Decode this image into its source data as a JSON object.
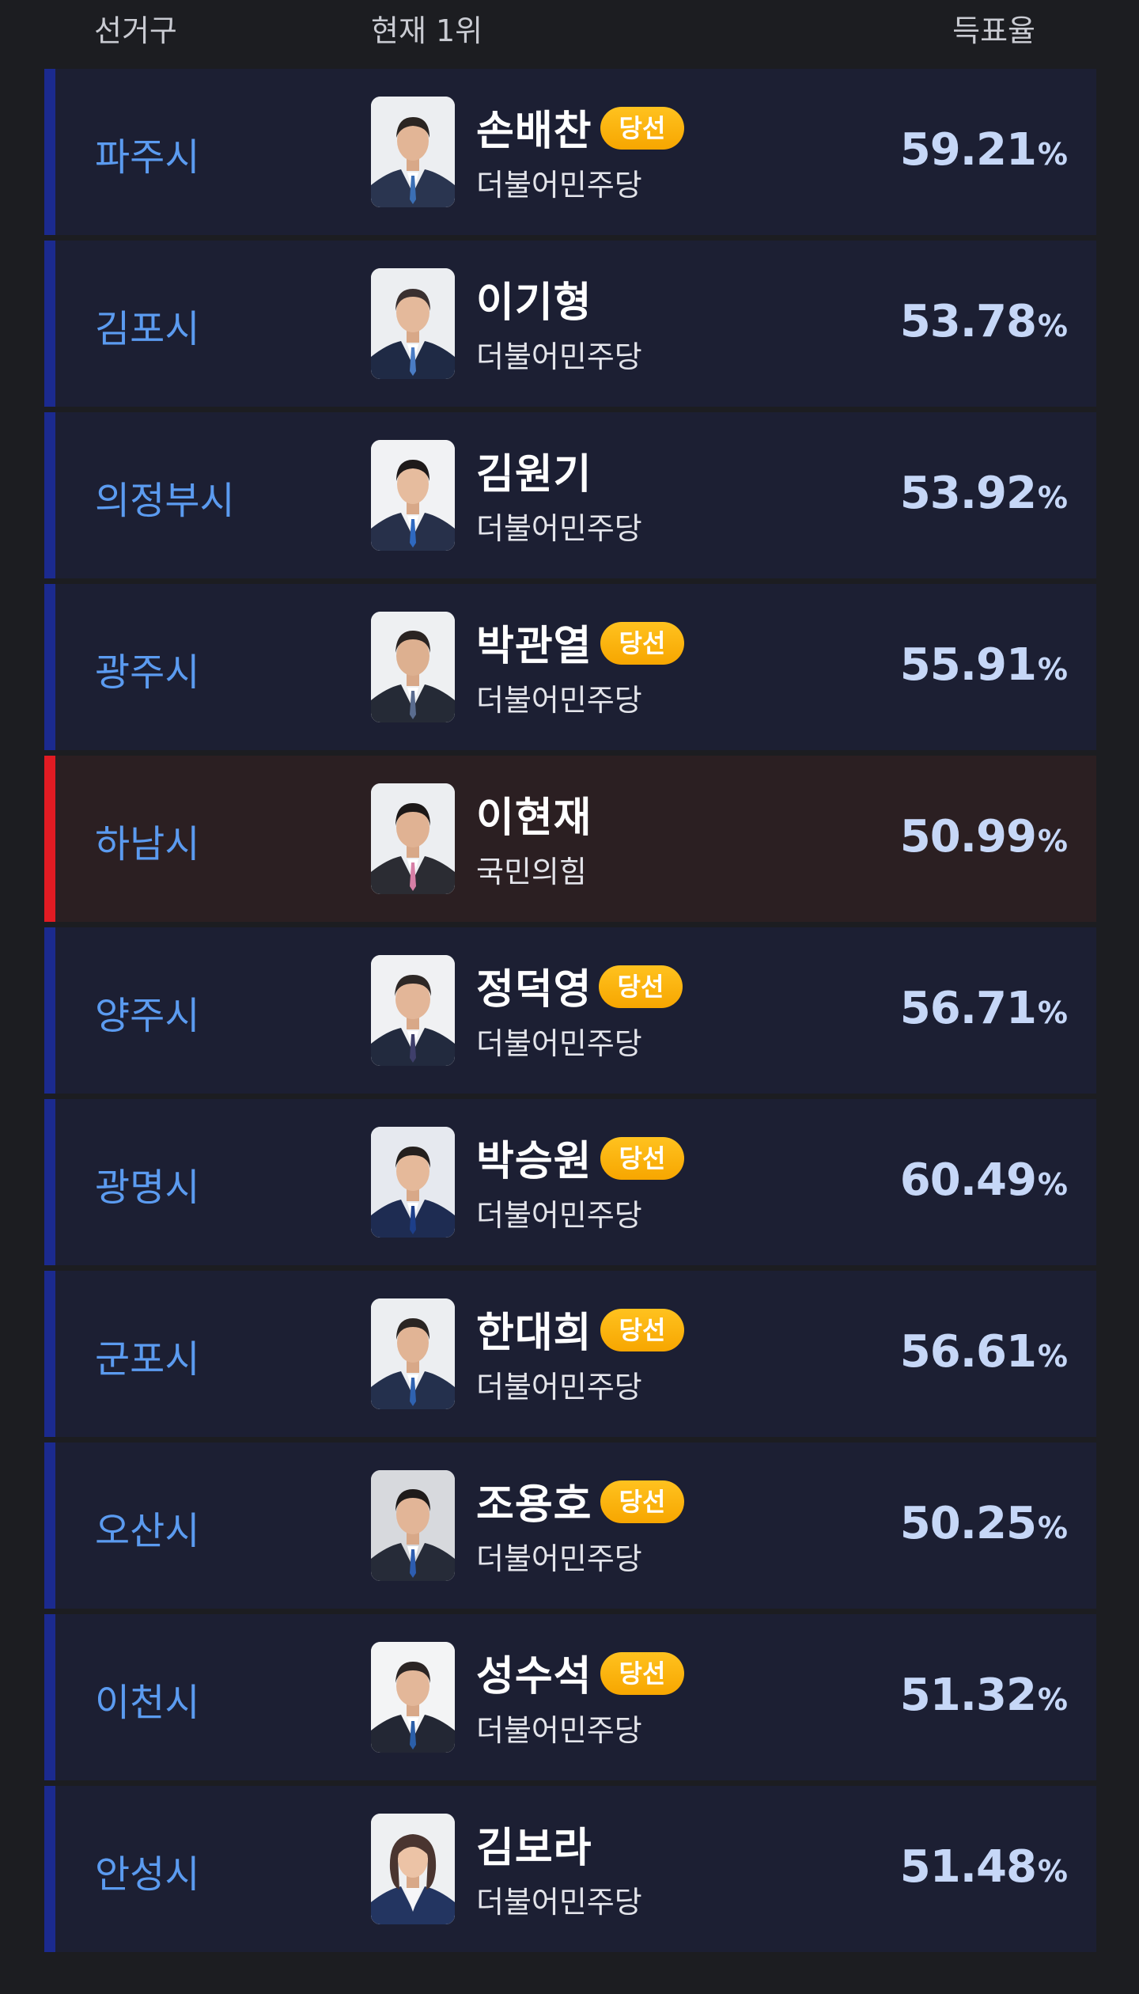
{
  "header": {
    "district": "선거구",
    "leader": "현재 1위",
    "rate": "득표율"
  },
  "colors": {
    "democratic_bar": "#1b2a8f",
    "ppp_bar": "#e11b23",
    "district_text": "#5b9bf0",
    "badge": "#f7a600",
    "rate_text": "#c6d7f7"
  },
  "rows": [
    {
      "district": "파주시",
      "name": "손배찬",
      "badge": "당선",
      "party": "더불어민주당",
      "rate": "59.21",
      "pct": "%"
    },
    {
      "district": "김포시",
      "name": "이기형",
      "badge": "",
      "party": "더불어민주당",
      "rate": "53.78",
      "pct": "%"
    },
    {
      "district": "의정부시",
      "name": "김원기",
      "badge": "",
      "party": "더불어민주당",
      "rate": "53.92",
      "pct": "%"
    },
    {
      "district": "광주시",
      "name": "박관열",
      "badge": "당선",
      "party": "더불어민주당",
      "rate": "55.91",
      "pct": "%"
    },
    {
      "district": "하남시",
      "name": "이현재",
      "badge": "",
      "party": "국민의힘",
      "rate": "50.99",
      "pct": "%"
    },
    {
      "district": "양주시",
      "name": "정덕영",
      "badge": "당선",
      "party": "더불어민주당",
      "rate": "56.71",
      "pct": "%"
    },
    {
      "district": "광명시",
      "name": "박승원",
      "badge": "당선",
      "party": "더불어민주당",
      "rate": "60.49",
      "pct": "%"
    },
    {
      "district": "군포시",
      "name": "한대희",
      "badge": "당선",
      "party": "더불어민주당",
      "rate": "56.61",
      "pct": "%"
    },
    {
      "district": "오산시",
      "name": "조용호",
      "badge": "당선",
      "party": "더불어민주당",
      "rate": "50.25",
      "pct": "%"
    },
    {
      "district": "이천시",
      "name": "성수석",
      "badge": "당선",
      "party": "더불어민주당",
      "rate": "51.32",
      "pct": "%"
    },
    {
      "district": "안성시",
      "name": "김보라",
      "badge": "",
      "party": "더불어민주당",
      "rate": "51.48",
      "pct": "%"
    }
  ]
}
